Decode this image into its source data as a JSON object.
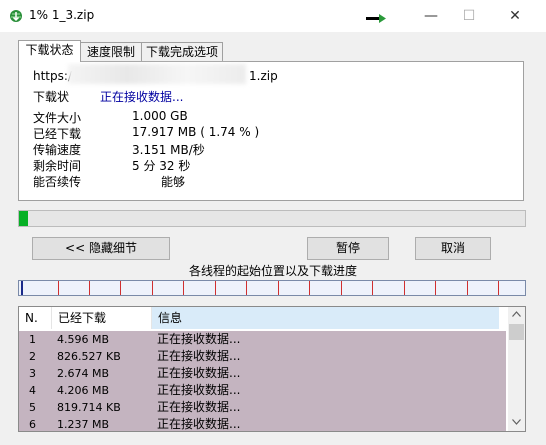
{
  "window": {
    "title": "1% 1_3.zip",
    "minimize": "—",
    "maximize": "☐",
    "close": "✕"
  },
  "tabs": [
    "下载状态",
    "速度限制",
    "下载完成选项"
  ],
  "info": {
    "url_prefix": "https:/",
    "url_suffix": "1.zip",
    "status_label": "下载状",
    "status_value": "正在接收数据...",
    "rows": [
      {
        "label": "文件大小",
        "value": "1.000  GB"
      },
      {
        "label": "已经下载",
        "value": "17.917  MB  ( 1.74 % )"
      },
      {
        "label": "传输速度",
        "value": "3.151  MB/秒"
      },
      {
        "label": "剩余时间",
        "value": "5 分 32 秒"
      },
      {
        "label": "能否续传",
        "value": "能够"
      }
    ]
  },
  "progress": {
    "percent": 1.74
  },
  "buttons": {
    "hide_details": "<< 隐藏细节",
    "pause": "暂停",
    "cancel": "取消"
  },
  "segments_caption": "各线程的起始位置以及下载进度",
  "table": {
    "columns": [
      "N.",
      "已经下载",
      "信息"
    ],
    "rows": [
      [
        "1",
        "4.596  MB",
        "正在接收数据..."
      ],
      [
        "2",
        "826.527  KB",
        "正在接收数据..."
      ],
      [
        "3",
        "2.674  MB",
        "正在接收数据..."
      ],
      [
        "4",
        "4.206  MB",
        "正在接收数据..."
      ],
      [
        "5",
        "819.714  KB",
        "正在接收数据..."
      ],
      [
        "6",
        "1.237  MB",
        "正在接收数据..."
      ]
    ]
  },
  "colors": {
    "progress": "#06b025",
    "row_bg": "#c4b4c0",
    "link_blue": "#0000a0",
    "thread_marker": "#d03030"
  }
}
